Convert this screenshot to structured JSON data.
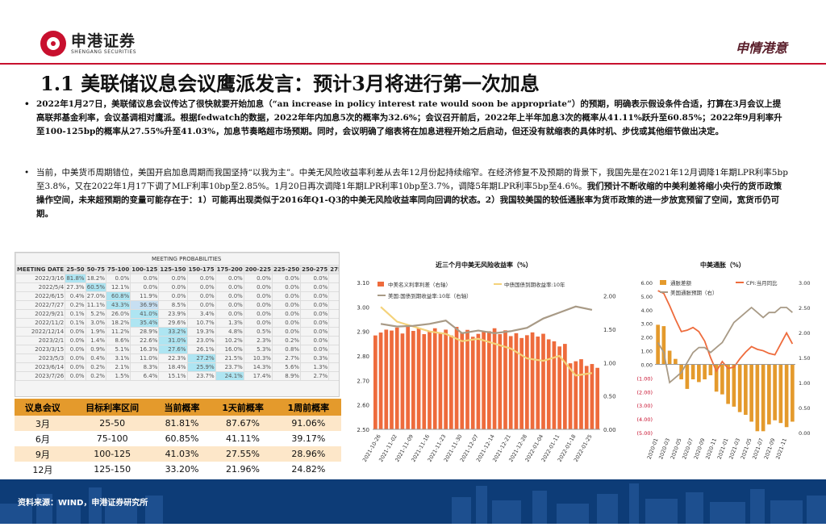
{
  "header": {
    "logo_cn": "申港证券",
    "logo_en": "SHENGANG SECURITIES",
    "slogan": "申情港意"
  },
  "title": "1.1 美联储议息会议鹰派发言：预计3月将进行第一次加息",
  "bullets": {
    "b1": "2022年1月27日，美联储议息会议传达了很快就要开始加息（“an increase in policy interest rate would soon be appropriate”）的预期，明确表示假设条件合适，打算在3月会议上提高联邦基金利率，会议基调相对鹰派。根据fedwatch的数据，2022年年内加息5次的概率为32.6%；会议召开前后，2022年上半年加息3次的概率从41.11%跃升至60.85%；2022年9月利率升至100-125bp的概率从27.55%升至41.03%，加息节奏略超市场预期。同时，会议明确了缩表将在加息进程开始之后启动，但还没有就缩表的具体时机、步伐或其他细节做出决定。",
    "b2_normal": "当前，中美货币周期错位，美国开启加息周期而我国坚持“以我为主”。中美无风险收益率利差从去年12月份起持续缩窄。在经济修复不及预期的背景下，我国先是在2021年12月调降1年期LPR利率5bp至3.8%，又在2022年1月17下调了MLF利率10bp至2.85%。1月20日再次调降1年期LPR利率10bp至3.7%，调降5年期LPR利率5bp至4.6%。",
    "b2_bold": "我们预计不断收缩的中美利差将缩小央行的货币政策操作空间，未来超预期的变量可能存在于：1）可能再出现类似于2016年Q1-Q3的中美无风险收益率同向回调的状态。2）我国较美国的较低通胀率为货币政策的进一步放宽预留了空间，宽货币仍可期。",
    "marker": "•"
  },
  "probabilities": {
    "caption": "MEETING PROBABILITIES",
    "headers": [
      "MEETING DATE",
      "25-50",
      "50-75",
      "75-100",
      "100-125",
      "125-150",
      "150-175",
      "175-200",
      "200-225",
      "225-250",
      "250-275",
      "275-300"
    ],
    "rows": [
      [
        "2022/3/16",
        "81.8%",
        "18.2%",
        "0.0%",
        "0.0%",
        "0.0%",
        "0.0%",
        "0.0%",
        "0.0%",
        "0.0%",
        "0.0%",
        "0.0%"
      ],
      [
        "2022/5/4",
        "27.3%",
        "60.5%",
        "12.1%",
        "0.0%",
        "0.0%",
        "0.0%",
        "0.0%",
        "0.0%",
        "0.0%",
        "0.0%",
        "0.0%"
      ],
      [
        "2022/6/15",
        "0.4%",
        "27.0%",
        "60.8%",
        "11.9%",
        "0.0%",
        "0.0%",
        "0.0%",
        "0.0%",
        "0.0%",
        "0.0%",
        "0.0%"
      ],
      [
        "2022/7/27",
        "0.2%",
        "11.1%",
        "43.3%",
        "36.9%",
        "8.5%",
        "0.0%",
        "0.0%",
        "0.0%",
        "0.0%",
        "0.0%",
        "0.0%"
      ],
      [
        "2022/9/21",
        "0.1%",
        "5.2%",
        "26.0%",
        "41.0%",
        "23.9%",
        "3.4%",
        "0.0%",
        "0.0%",
        "0.0%",
        "0.0%",
        "0.0%"
      ],
      [
        "2022/11/2",
        "0.1%",
        "3.0%",
        "18.2%",
        "35.4%",
        "29.6%",
        "10.7%",
        "1.3%",
        "0.0%",
        "0.0%",
        "0.0%",
        "0.0%"
      ],
      [
        "2022/12/14",
        "0.0%",
        "1.9%",
        "11.2%",
        "28.9%",
        "33.2%",
        "19.3%",
        "4.8%",
        "0.5%",
        "0.0%",
        "0.0%",
        "0.0%"
      ],
      [
        "2023/2/1",
        "0.0%",
        "1.4%",
        "8.6%",
        "22.6%",
        "31.0%",
        "23.0%",
        "10.2%",
        "2.3%",
        "0.2%",
        "0.0%",
        "0.0%"
      ],
      [
        "2023/3/15",
        "0.0%",
        "0.9%",
        "5.1%",
        "16.3%",
        "27.6%",
        "26.1%",
        "16.0%",
        "5.3%",
        "0.8%",
        "0.0%",
        "0.0%"
      ],
      [
        "2023/5/3",
        "0.0%",
        "0.4%",
        "3.1%",
        "11.0%",
        "22.3%",
        "27.2%",
        "21.5%",
        "10.3%",
        "2.7%",
        "0.3%",
        "0.0%"
      ],
      [
        "2023/6/14",
        "0.0%",
        "0.2%",
        "2.1%",
        "8.3%",
        "18.4%",
        "25.9%",
        "23.7%",
        "14.3%",
        "5.6%",
        "1.3%",
        "0.2%"
      ],
      [
        "2023/7/26",
        "0.0%",
        "0.2%",
        "1.5%",
        "6.4%",
        "15.1%",
        "23.7%",
        "24.1%",
        "17.4%",
        "8.9%",
        "2.7%",
        "0.4%"
      ]
    ]
  },
  "summary": {
    "headers": [
      "议息会议",
      "目标利率区间",
      "当前概率",
      "1天前概率",
      "1周前概率"
    ],
    "rows": [
      [
        "3月",
        "25-50",
        "81.81%",
        "87.67%",
        "91.06%"
      ],
      [
        "6月",
        "75-100",
        "60.85%",
        "41.11%",
        "39.17%"
      ],
      [
        "9月",
        "100-125",
        "41.03%",
        "27.55%",
        "28.96%"
      ],
      [
        "12月",
        "125-150",
        "33.20%",
        "21.96%",
        "24.82%"
      ]
    ]
  },
  "chart1": {
    "title": "近三个月中美无风险收益率（%）",
    "legend": [
      "中美名义利率利差（右轴）",
      "中债国债到期收益率:10年",
      "美国:国债到期收益率:10年（右轴）"
    ],
    "left_ticks": [
      "2.50",
      "2.60",
      "2.70",
      "2.80",
      "2.90",
      "3.00",
      "3.10"
    ],
    "right_ticks": [
      "0.00",
      "0.50",
      "1.00",
      "1.50",
      "2.00"
    ],
    "x_labels": [
      "2021-10-26",
      "2021-11-02",
      "2021-11-09",
      "2021-11-16",
      "2021-11-23",
      "2021-11-30",
      "2021-12-07",
      "2021-12-14",
      "2021-12-21",
      "2021-12-28",
      "2022-01-04",
      "2022-01-11",
      "2022-01-18",
      "2022-01-25"
    ],
    "colors": {
      "bars": "#ee6b3c",
      "cn10y": "#f4d27a",
      "us10y": "#a89a86"
    }
  },
  "chart2": {
    "title": "中美通胀（%）",
    "legend": [
      "通胀差额",
      "CPI:当月同比",
      "美国通胀预期（右）"
    ],
    "left_ticks": [
      "(5.00)",
      "(4.00)",
      "(3.00)",
      "(2.00)",
      "(1.00)",
      "0.00",
      "1.00",
      "2.00",
      "3.00",
      "4.00",
      "5.00",
      "6.00"
    ],
    "right_ticks": [
      "0.00",
      "0.50",
      "1.00",
      "1.50",
      "2.00",
      "2.50",
      "3.00"
    ],
    "x_labels": [
      "2020-01",
      "2020-03",
      "2020-05",
      "2020-07",
      "2020-09",
      "2020-11",
      "2021-01",
      "2021-03",
      "2021-05",
      "2021-07",
      "2021-09",
      "2021-11"
    ],
    "colors": {
      "bars": "#e49a2c",
      "cpi": "#ee6b3c",
      "exp": "#a89a86"
    }
  },
  "chart_data": [
    {
      "type": "bar",
      "title": "近三个月中美无风险收益率（%）",
      "x": [
        "2021-10-26",
        "2021-11-02",
        "2021-11-09",
        "2021-11-16",
        "2021-11-23",
        "2021-11-30",
        "2021-12-07",
        "2021-12-14",
        "2021-12-21",
        "2021-12-28",
        "2022-01-04",
        "2022-01-11",
        "2022-01-18",
        "2022-01-25"
      ],
      "ylim": [
        2.5,
        3.1
      ],
      "y2lim": [
        0,
        2.2
      ],
      "series": [
        {
          "name": "中美名义利率利差（右轴）",
          "axis": "right",
          "type": "bar",
          "values": [
            1.45,
            1.48,
            1.52,
            1.47,
            1.45,
            1.49,
            1.43,
            1.47,
            1.44,
            1.41,
            1.39,
            1.28,
            1.02,
            0.95
          ]
        },
        {
          "name": "中债国债到期收益率:10年",
          "axis": "left",
          "type": "line",
          "values": [
            3.0,
            2.94,
            2.92,
            2.9,
            2.89,
            2.86,
            2.87,
            2.85,
            2.83,
            2.79,
            2.78,
            2.8,
            2.72,
            2.73
          ]
        },
        {
          "name": "美国:国债到期收益率:10年（右轴）",
          "axis": "right",
          "type": "line",
          "values": [
            1.58,
            1.54,
            1.55,
            1.58,
            1.63,
            1.44,
            1.48,
            1.44,
            1.47,
            1.52,
            1.66,
            1.75,
            1.84,
            1.79
          ]
        }
      ]
    },
    {
      "type": "bar",
      "title": "中美通胀（%）",
      "x": [
        "2020-01",
        "2020-03",
        "2020-05",
        "2020-07",
        "2020-09",
        "2020-11",
        "2021-01",
        "2021-03",
        "2021-05",
        "2021-07",
        "2021-09",
        "2021-11"
      ],
      "ylim": [
        -5,
        6
      ],
      "y2lim": [
        0,
        3
      ],
      "series": [
        {
          "name": "通胀差额",
          "axis": "left",
          "type": "bar",
          "values": [
            2.9,
            2.8,
            1.0,
            0.4,
            -1.1,
            -1.8,
            -1.1,
            -1.3,
            -1.1,
            -0.8,
            -2.0,
            -2.2,
            -2.9,
            -3.1,
            -3.5,
            -3.7,
            -4.2,
            -4.9,
            -4.9,
            -4.4,
            -4.1,
            -4.3,
            -4.6,
            -4.2
          ]
        },
        {
          "name": "CPI:当月同比",
          "axis": "left",
          "type": "line",
          "values": [
            5.4,
            5.2,
            4.3,
            3.3,
            2.4,
            2.5,
            2.7,
            2.4,
            1.7,
            0.5,
            -0.5,
            0.2,
            -0.3,
            -0.2,
            0.4,
            0.9,
            1.3,
            1.1,
            1.0,
            0.8,
            0.7,
            1.5,
            2.3,
            1.5
          ]
        },
        {
          "name": "美国通胀预期（右）",
          "axis": "right",
          "type": "line",
          "values": [
            1.8,
            1.6,
            1.0,
            1.1,
            1.2,
            1.4,
            1.6,
            1.7,
            1.7,
            1.6,
            1.7,
            1.8,
            2.0,
            2.2,
            2.3,
            2.4,
            2.5,
            2.4,
            2.3,
            2.4,
            2.4,
            2.5,
            2.5,
            2.4
          ]
        }
      ]
    }
  ],
  "footer": {
    "source": "资料来源：WIND，申港证券研究所"
  }
}
